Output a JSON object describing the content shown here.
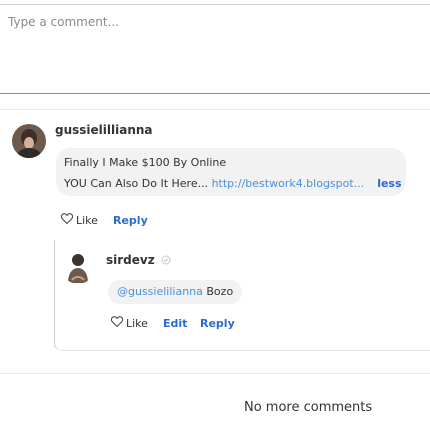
{
  "comment_box": {
    "placeholder": "Type a comment..."
  },
  "comment": {
    "author": "gussielillianna",
    "text_line1": "Finally I Make $100 By Online",
    "text_line2_prefix": "YOU Can Also Do It Here... ",
    "link_text": "http://bestwork4.blogspot...",
    "less_label": "less",
    "like_label": "Like",
    "reply_label": "Reply"
  },
  "reply": {
    "author": "sirdevz",
    "mention": "@gussielilianna",
    "text": " Bozo",
    "like_label": "Like",
    "edit_label": "Edit",
    "reply_label": "Reply"
  },
  "footer": {
    "no_more_label": "No more comments"
  },
  "colors": {
    "link": "#4a90d9",
    "action": "#2a6cd1",
    "bubble": "#f2f2f2"
  },
  "icons": {
    "like": "heart-outline-icon",
    "status": "tick-icon"
  }
}
